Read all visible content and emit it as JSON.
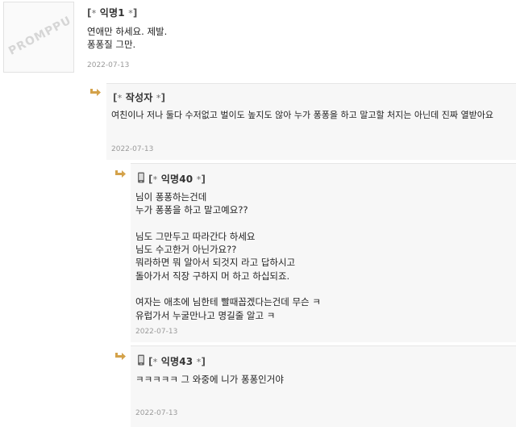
{
  "comments": [
    {
      "author": "익명1",
      "lines": [
        "연애만 하세요. 제발.",
        "퐁퐁질 그만."
      ],
      "date": "2022-07-13"
    },
    {
      "author": "작성자",
      "lines": [
        "여친이나 저나 둘다 수저없고 벌이도 높지도 않아 누가 퐁퐁을 하고 말고할 처지는 아닌데 진짜 열받아요"
      ],
      "date": "2022-07-13"
    },
    {
      "author": "익명40",
      "lines": [
        "님이 퐁퐁하는건데",
        "누가 퐁퐁을 하고 말고예요??",
        "",
        "님도 그만두고 따라간다 하세요",
        "님도 수고한거 아닌가요??",
        "뭐라하면 뭐 알아서 되것지 라고 답하시고",
        "돌아가서 직장 구하지 머 하고 하십되죠.",
        "",
        "여자는 애초에 님한테 빨때꼽겠다는건데 무슨 ㅋ",
        "유럽가서 누굴만나고 명길줄 알고 ㅋ"
      ],
      "date": "2022-07-13"
    },
    {
      "author": "익명43",
      "lines": [
        "ㅋㅋㅋㅋㅋ 그 와중에 니가 퐁퐁인거야"
      ],
      "date": "2022-07-13"
    }
  ],
  "avatar_watermark": "PROMPPU",
  "author_prefix": "[",
  "author_suffix": "]",
  "star_glyph": "*",
  "colors": {
    "reply_arrow": "#d4a24a",
    "reply_bg": "#f7f7f7",
    "date_text": "#9a9a9a"
  }
}
